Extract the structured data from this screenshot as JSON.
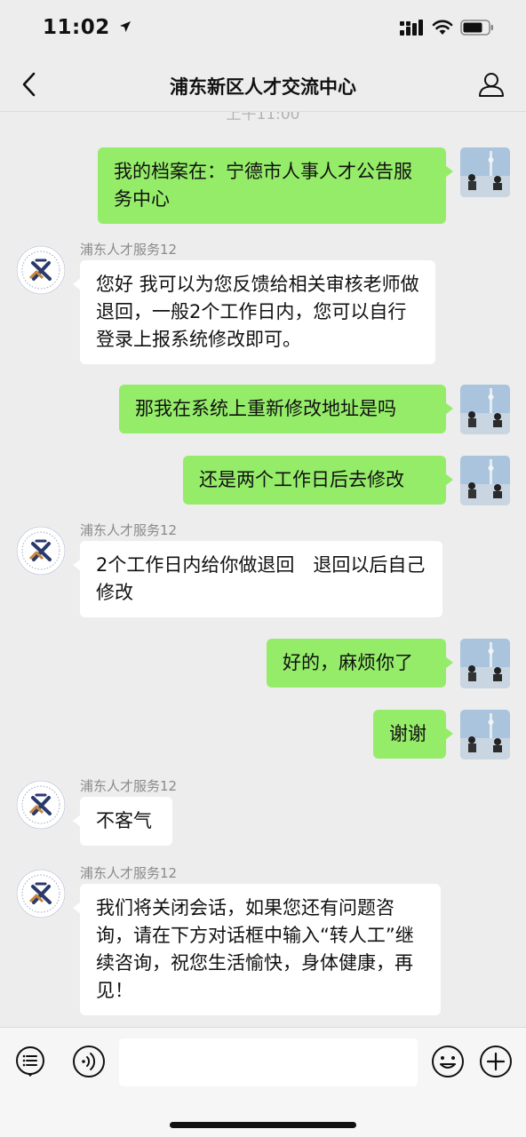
{
  "status_bar": {
    "time": "11:02"
  },
  "nav": {
    "title": "浦东新区人才交流中心"
  },
  "chat": {
    "timestamp": "上午11:00",
    "messages": [
      {
        "sender": "self",
        "text": "我的档案在：宁德市人事人才公告服务中心"
      },
      {
        "sender": "agent",
        "name": "浦东人才服务12",
        "text": "您好 我可以为您反馈给相关审核老师做退回，一般2个工作日内，您可以自行登录上报系统修改即可。"
      },
      {
        "sender": "self",
        "text": "那我在系统上重新修改地址是吗"
      },
      {
        "sender": "self",
        "text": "还是两个工作日后去修改"
      },
      {
        "sender": "agent",
        "name": "浦东人才服务12",
        "text": "2个工作日内给你做退回　退回以后自己修改"
      },
      {
        "sender": "self",
        "text": "好的，麻烦你了"
      },
      {
        "sender": "self",
        "text": "谢谢"
      },
      {
        "sender": "agent",
        "name": "浦东人才服务12",
        "text": "不客气"
      },
      {
        "sender": "agent",
        "name": "浦东人才服务12",
        "text": "我们将关闭会话，如果您还有问题咨询，请在下方对话框中输入“转人工”继续咨询，祝您生活愉快，身体健康，再见！"
      }
    ]
  },
  "input_bar": {
    "text_value": ""
  },
  "colors": {
    "self_bubble": "#95ec69",
    "agent_bubble": "#ffffff",
    "background": "#ededed",
    "agent_logo_navy": "#2a3a6b",
    "agent_logo_orange": "#c8873a"
  },
  "icons": [
    "location-arrow-icon",
    "cellular-signal-icon",
    "wifi-icon",
    "battery-icon",
    "back-chevron-icon",
    "profile-icon",
    "menu-list-icon",
    "voice-icon",
    "emoji-icon",
    "add-icon"
  ]
}
